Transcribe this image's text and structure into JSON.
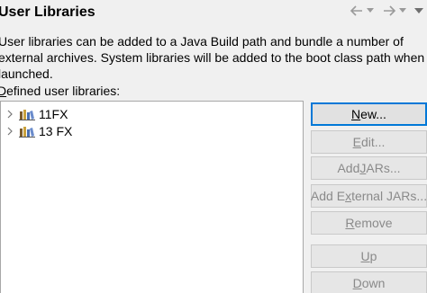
{
  "header": {
    "title": "User Libraries",
    "nav": {
      "back_icon": "back-arrow-icon",
      "back_menu_icon": "chevron-down-icon",
      "forward_icon": "forward-arrow-icon",
      "forward_menu_icon": "chevron-down-icon",
      "menu_icon": "view-menu-icon"
    }
  },
  "description": "User libraries can be added to a Java Build path and bundle a number of\nexternal archives. System libraries will be added to the boot class path when\nlaunched.",
  "list": {
    "label_prefix": "D",
    "label_rest": "efined user libraries:",
    "items": [
      {
        "label": "11FX",
        "icon": "library-icon",
        "expanded": false
      },
      {
        "label": "13 FX",
        "icon": "library-icon",
        "expanded": false
      }
    ]
  },
  "buttons": {
    "new": {
      "before": "",
      "mnemonic": "N",
      "after": "ew...",
      "enabled": true
    },
    "edit": {
      "before": "",
      "mnemonic": "E",
      "after": "dit...",
      "enabled": false
    },
    "add_jars": {
      "before": "Add ",
      "mnemonic": "J",
      "after": "ARs...",
      "enabled": false
    },
    "add_external": {
      "before": "Add E",
      "mnemonic": "x",
      "after": "ternal JARs...",
      "enabled": false
    },
    "remove": {
      "before": "",
      "mnemonic": "R",
      "after": "emove",
      "enabled": false
    },
    "up": {
      "before": "",
      "mnemonic": "U",
      "after": "p",
      "enabled": false
    },
    "down": {
      "before": "",
      "mnemonic": "D",
      "after": "own",
      "enabled": false
    }
  },
  "colors": {
    "background": "#f0f0f0",
    "list_background": "#ffffff",
    "disabled_text": "#8a8a8a",
    "focus_border": "#0078d7"
  }
}
